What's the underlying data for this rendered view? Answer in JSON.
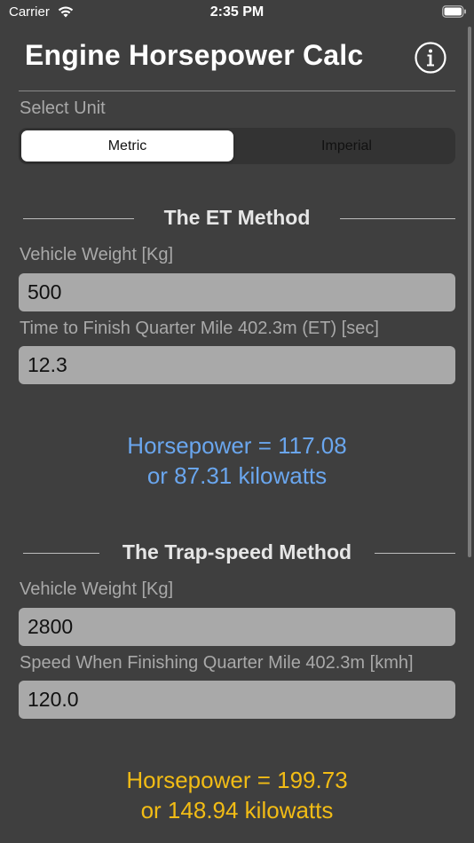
{
  "status_bar": {
    "carrier": "Carrier",
    "time": "2:35 PM"
  },
  "header": {
    "title": "Engine Horsepower Calc",
    "info_icon": "info-circle-icon"
  },
  "unit_selector": {
    "label": "Select Unit",
    "options": [
      "Metric",
      "Imperial"
    ],
    "selected": "Metric"
  },
  "et_method": {
    "heading": "The ET Method",
    "weight_label": "Vehicle Weight [Kg]",
    "weight_value": "500",
    "time_label": "Time to Finish Quarter Mile 402.3m (ET) [sec]",
    "time_value": "12.3",
    "result_hp": "Horsepower = 117.08",
    "result_kw": "or 87.31 kilowatts",
    "result_color": "#6aa6ee"
  },
  "trap_method": {
    "heading": "The Trap-speed Method",
    "weight_label": "Vehicle Weight [Kg]",
    "weight_value": "2800",
    "speed_label": "Speed When Finishing Quarter Mile 402.3m [kmh]",
    "speed_value": "120.0",
    "result_hp": "Horsepower = 199.73",
    "result_kw": "or 148.94 kilowatts",
    "result_color": "#f2bc15"
  },
  "colors": {
    "background": "#3f3f3f",
    "input_fill": "#a9a9a9",
    "label_gray": "#a9a9a9"
  }
}
